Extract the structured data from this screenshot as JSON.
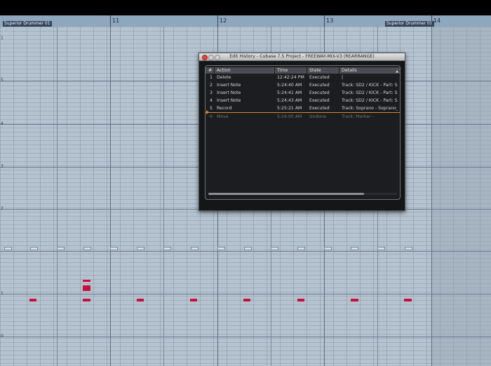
{
  "ruler": {
    "bars": [
      {
        "label": "11"
      },
      {
        "label": "12"
      },
      {
        "label": "13"
      },
      {
        "label": "14"
      }
    ],
    "regions": [
      {
        "label": "Superior Drummer 01"
      },
      {
        "label": "Superior Drummer 01"
      }
    ]
  },
  "key_labels": [
    "1",
    "5",
    "4",
    "3",
    "2",
    "1",
    "0"
  ],
  "history_window": {
    "title": "Edit History - Cubase 7.5 Project - FREEWAY-MIX-V3 (REARRANGE)",
    "columns": [
      "#",
      "Action",
      "Time",
      "State",
      "Details"
    ],
    "rows": [
      {
        "num": "1",
        "action": "Delete",
        "time": "12:42:24 PM",
        "state": "Executed",
        "details": "|"
      },
      {
        "num": "2",
        "action": "Insert Note",
        "time": "5:24:40 AM",
        "state": "Executed",
        "details": "Track: SD2 / KICK - Part: S"
      },
      {
        "num": "3",
        "action": "Insert Note",
        "time": "5:24:41 AM",
        "state": "Executed",
        "details": "Track: SD2 / KICK - Part: S"
      },
      {
        "num": "4",
        "action": "Insert Note",
        "time": "5:24:43 AM",
        "state": "Executed",
        "details": "Track: SD2 / KICK - Part: S"
      },
      {
        "num": "5",
        "action": "Record",
        "time": "5:25:21 AM",
        "state": "Executed",
        "details": "Track: Soprano - Soprano_"
      },
      {
        "num": "6",
        "action": "Move",
        "time": "5:26:00 AM",
        "state": "Undone",
        "details": "Track: Marker -"
      }
    ]
  },
  "colors": {
    "note": "#c8103a",
    "grid_bg": "#b5c3d0",
    "ruler_bg": "#8fa6bf",
    "cursor": "#d98724"
  }
}
